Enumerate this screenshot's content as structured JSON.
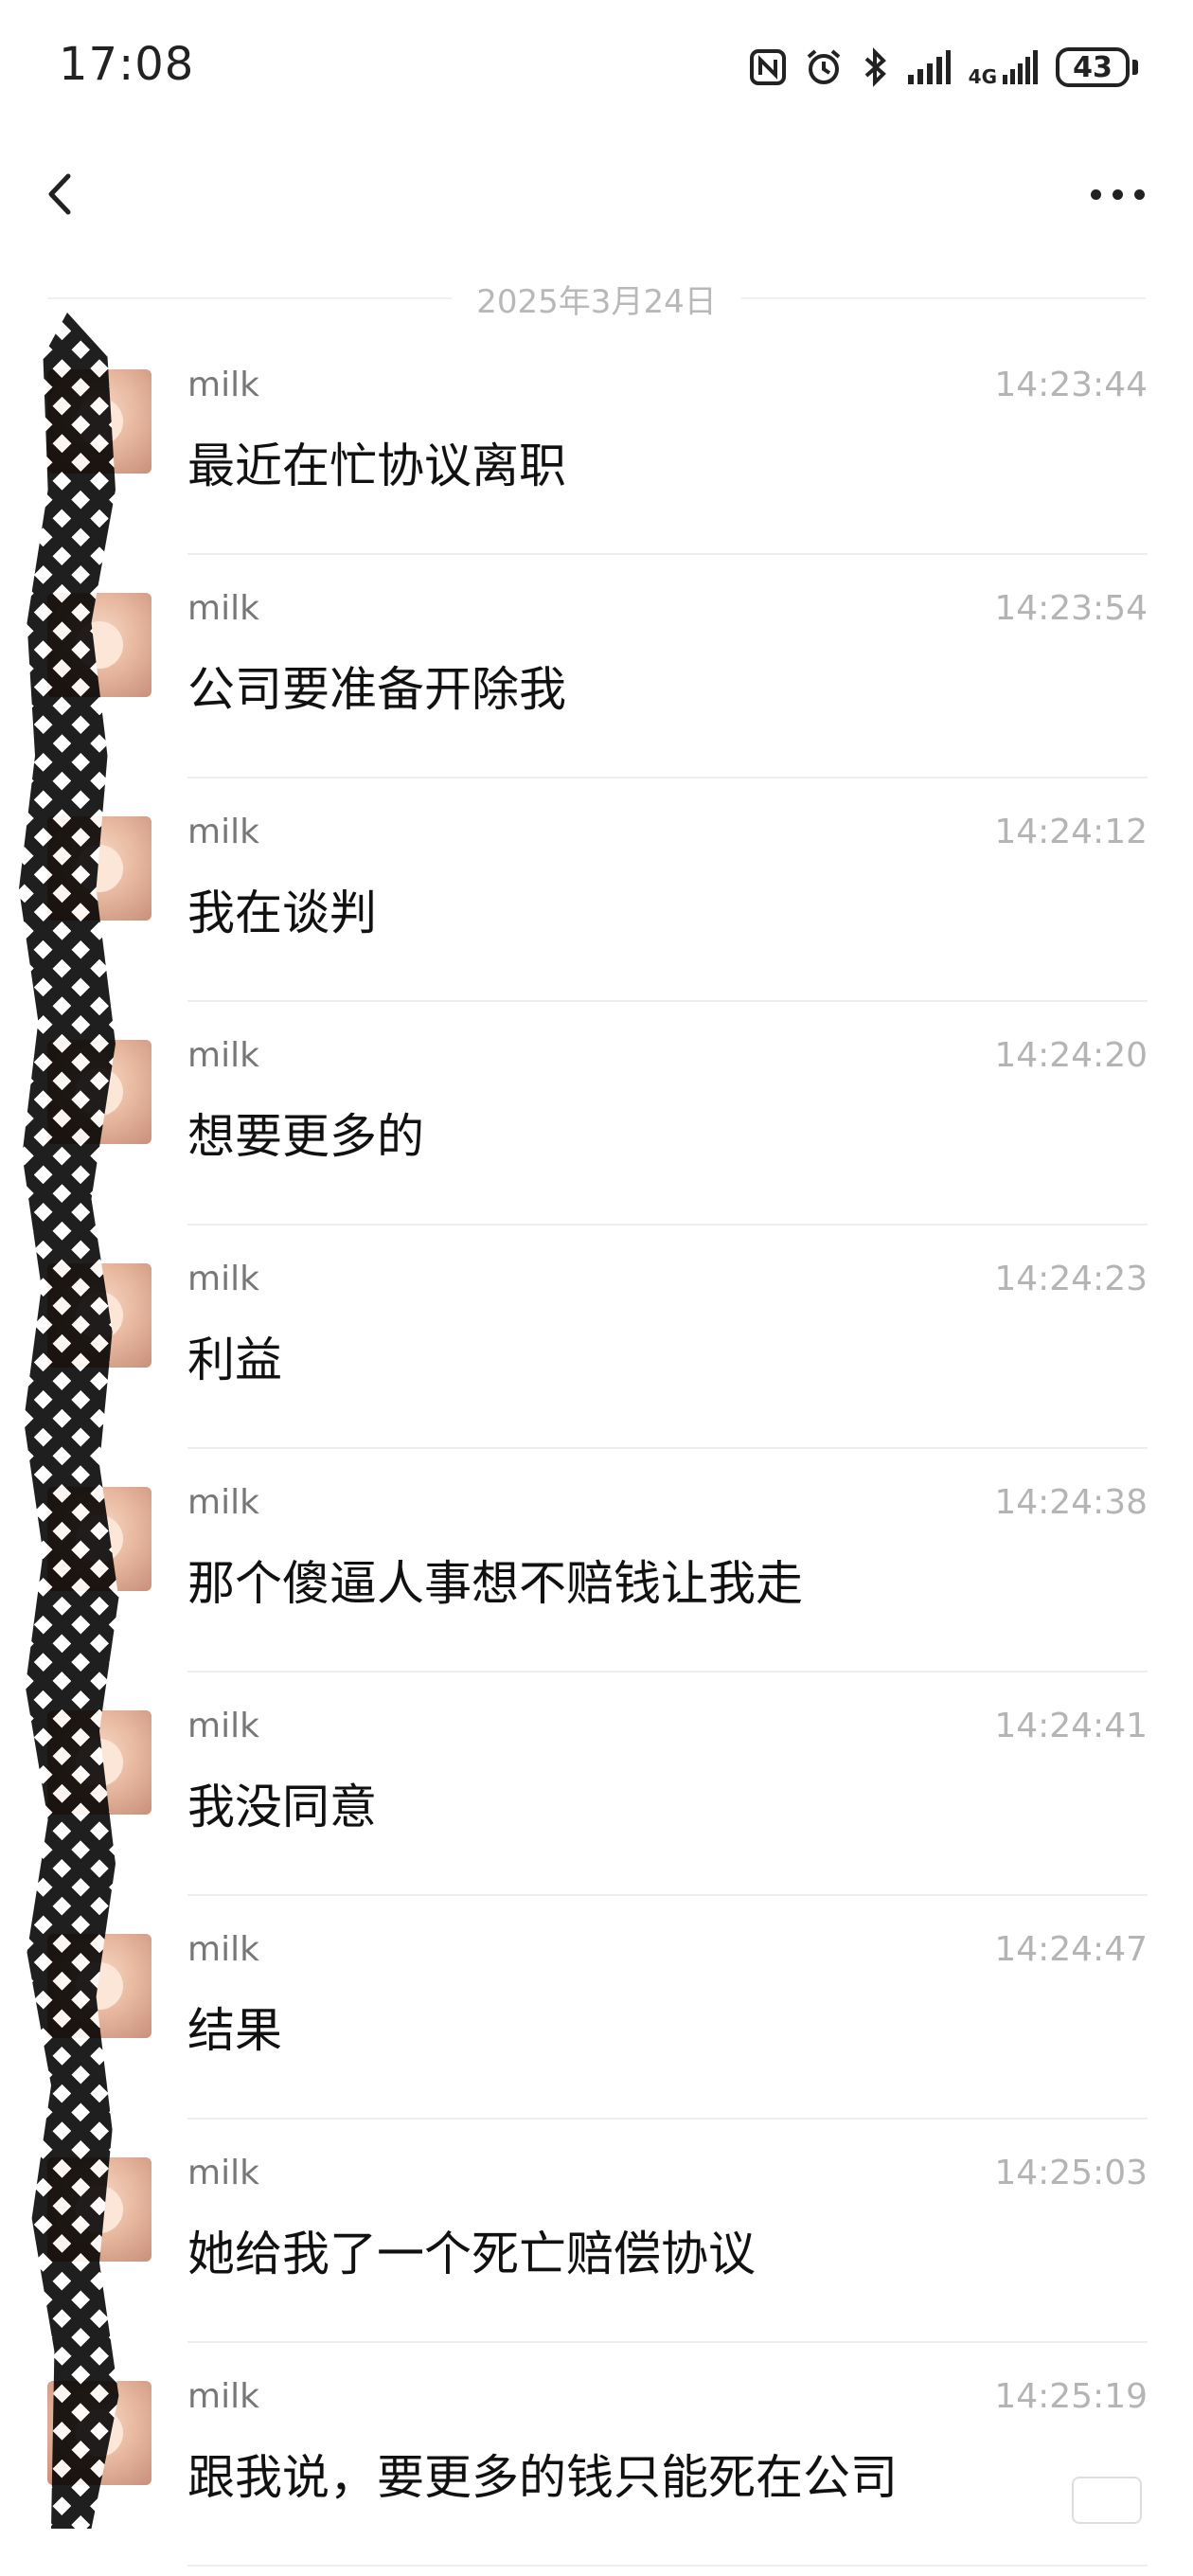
{
  "status_bar": {
    "time": "17:08",
    "battery": "43",
    "network_label": "4G",
    "icons": [
      "nfc-icon",
      "alarm-icon",
      "bluetooth-icon",
      "signal-icon",
      "signal-4g-icon",
      "battery-icon"
    ]
  },
  "nav": {
    "back_icon": "chevron-left-icon",
    "more_icon": "more-horizontal-icon"
  },
  "date_divider": "2025年3月24日",
  "messages": [
    {
      "sender": "milk",
      "time": "14:23:44",
      "text": "最近在忙协议离职"
    },
    {
      "sender": "milk",
      "time": "14:23:54",
      "text": "公司要准备开除我"
    },
    {
      "sender": "milk",
      "time": "14:24:12",
      "text": "我在谈判"
    },
    {
      "sender": "milk",
      "time": "14:24:20",
      "text": "想要更多的"
    },
    {
      "sender": "milk",
      "time": "14:24:23",
      "text": "利益"
    },
    {
      "sender": "milk",
      "time": "14:24:38",
      "text": "那个傻逼人事想不赔钱让我走"
    },
    {
      "sender": "milk",
      "time": "14:24:41",
      "text": "我没同意"
    },
    {
      "sender": "milk",
      "time": "14:24:47",
      "text": "结果"
    },
    {
      "sender": "milk",
      "time": "14:25:03",
      "text": "她给我了一个死亡赔偿协议"
    },
    {
      "sender": "milk",
      "time": "14:25:19",
      "text": "跟我说，要更多的钱只能死在公司"
    }
  ],
  "colors": {
    "background": "#ffffff",
    "sender": "#777777",
    "timestamp": "#b4b4b4",
    "message_text": "#111111",
    "divider": "#eeeeee"
  }
}
